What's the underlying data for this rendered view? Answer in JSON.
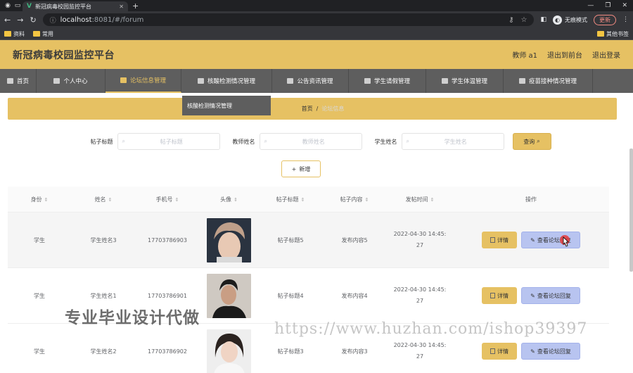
{
  "browser": {
    "tab_title": "新冠病毒校园监控平台",
    "url_host": "localhost",
    "url_path": ":8081/#/forum",
    "incognito_label": "无痕模式",
    "update_label": "更新",
    "bookmarks": [
      "资料",
      "常用"
    ],
    "bookmarks_right": "其他书签"
  },
  "header": {
    "title": "新冠病毒校园监控平台",
    "user": "教师 a1",
    "back_front": "退出到前台",
    "logout": "退出登录"
  },
  "menu": [
    {
      "label": "首页",
      "icon": "home-icon"
    },
    {
      "label": "个人中心",
      "icon": "user-icon"
    },
    {
      "label": "论坛信息管理",
      "icon": "forum-icon",
      "active": true
    },
    {
      "label": "核酸检测情况管理",
      "icon": "test-icon"
    },
    {
      "label": "公告资讯管理",
      "icon": "notice-icon"
    },
    {
      "label": "学生请假管理",
      "icon": "leave-icon"
    },
    {
      "label": "学生体温管理",
      "icon": "temp-icon"
    },
    {
      "label": "疫苗接种情况管理",
      "icon": "vaccine-icon"
    }
  ],
  "dropdown": {
    "item": "核酸检测情况管理"
  },
  "breadcrumb": {
    "home": "首页",
    "sep": "/",
    "current": "论坛信息"
  },
  "search": {
    "label1": "帖子标题",
    "ph1": "帖子标题",
    "label2": "教师姓名",
    "ph2": "教师姓名",
    "label3": "学生姓名",
    "ph3": "学生姓名",
    "query_label": "查询"
  },
  "add_label": "新增",
  "table": {
    "headers": [
      "身份",
      "姓名",
      "手机号",
      "头像",
      "帖子标题",
      "帖子内容",
      "发帖时间",
      "操作"
    ],
    "rows": [
      {
        "role": "学生",
        "name": "学生姓名3",
        "phone": "17703786903",
        "title": "帖子标题5",
        "content": "发布内容5",
        "time1": "2022-04-30 14:45:",
        "time2": "27"
      },
      {
        "role": "学生",
        "name": "学生姓名1",
        "phone": "17703786901",
        "title": "帖子标题4",
        "content": "发布内容4",
        "time1": "2022-04-30 14:45:",
        "time2": "27"
      },
      {
        "role": "学生",
        "name": "学生姓名2",
        "phone": "17703786902",
        "title": "帖子标题3",
        "content": "发布内容3",
        "time1": "2022-04-30 14:45:",
        "time2": "27"
      }
    ],
    "detail_label": "详情",
    "reply_label": "查看论坛回复"
  },
  "watermark": {
    "cn": "专业毕业设计代做",
    "url": "https://www.huzhan.com/ishop39397"
  }
}
